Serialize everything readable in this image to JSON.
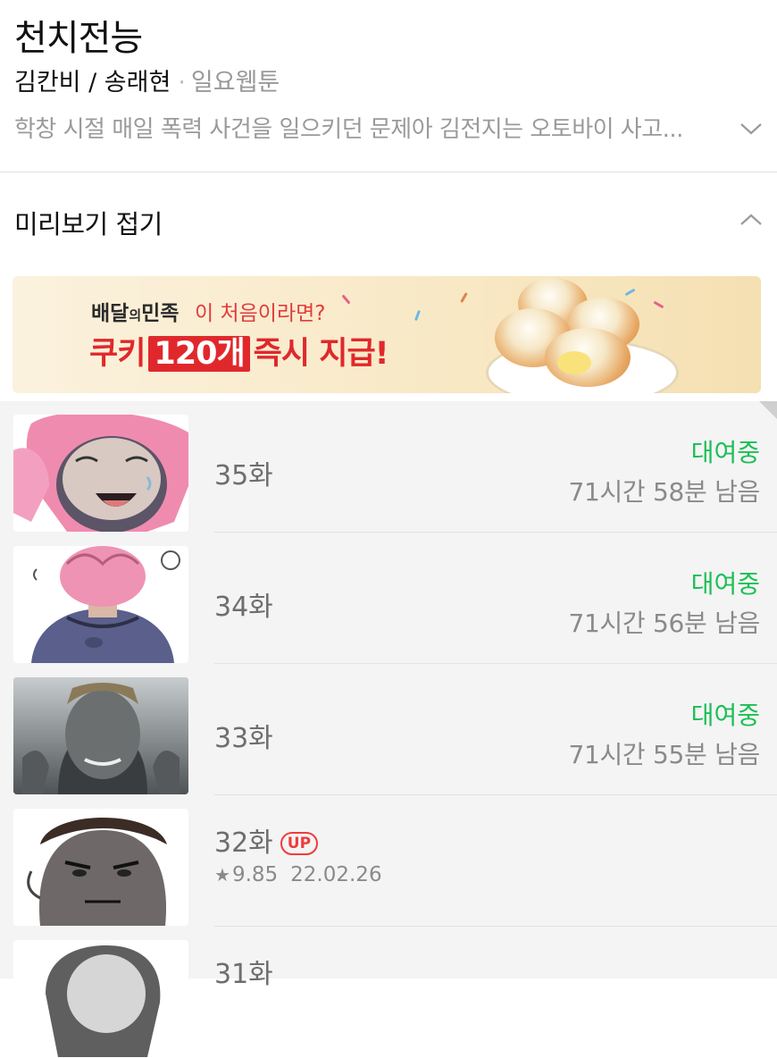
{
  "header": {
    "title": "천치전능",
    "authors": "김칸비 / 송래현",
    "genre": "일요웹툰",
    "synopsis": "학창 시절 매일 폭력 사건을 일으키던 문제아 김전지는 오토바이 사고...",
    "preview_label": "미리보기 접기"
  },
  "banner": {
    "brand_main": "배달",
    "brand_small": "의",
    "brand_tail": "민족",
    "intro": "이 처음이라면?",
    "promo_before": "쿠키",
    "promo_highlight": "120개",
    "promo_after": "즉시 지급!"
  },
  "episodes": [
    {
      "title": "35화",
      "status": "대여중",
      "remaining": "71시간 58분 남음"
    },
    {
      "title": "34화",
      "status": "대여중",
      "remaining": "71시간 56분 남음"
    },
    {
      "title": "33화",
      "status": "대여중",
      "remaining": "71시간 55분 남음"
    },
    {
      "title": "32화",
      "badge": "UP",
      "rating": "9.85",
      "date": "22.02.26"
    },
    {
      "title": "31화"
    }
  ],
  "icons": {
    "expand": "chevron-down-icon",
    "collapse": "chevron-up-icon",
    "rating": "star-icon"
  },
  "colors": {
    "rental_green": "#1bbf55",
    "up_badge_red": "#ef3c3c",
    "promo_red": "#e0282c"
  }
}
